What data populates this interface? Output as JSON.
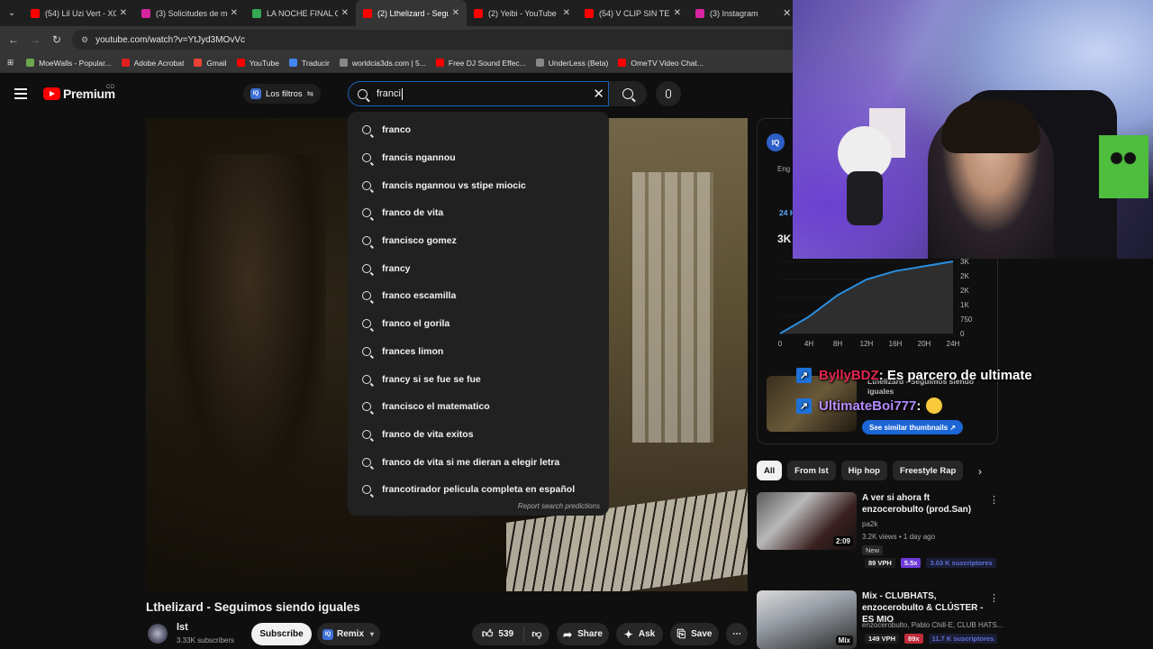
{
  "browser": {
    "tabs": [
      {
        "label": "(54) Lil Uzi Vert - XO",
        "color": "#ff0000",
        "active": false
      },
      {
        "label": "(3) Solicitudes de me",
        "color": "#d6249f",
        "active": false
      },
      {
        "label": "LA NOCHE FINAL CR",
        "color": "#34a853",
        "active": false
      },
      {
        "label": "(2) Lthelizard - Segui",
        "color": "#ff0000",
        "active": true
      },
      {
        "label": "(2) Yeibi - YouTube",
        "color": "#ff0000",
        "active": false
      },
      {
        "label": "(54) V CLIP SIN TEXT",
        "color": "#ff0000",
        "active": false
      },
      {
        "label": "(3) Instagram",
        "color": "#d6249f",
        "active": false
      }
    ],
    "url": "youtube.com/watch?v=YtJyd3MOvVc",
    "bookmarks": [
      {
        "label": "MoeWalls - Popular...",
        "color": "#6aa84f"
      },
      {
        "label": "Adobe Acrobat",
        "color": "#e02020"
      },
      {
        "label": "Gmail",
        "color": "#ea4335"
      },
      {
        "label": "YouTube",
        "color": "#ff0000"
      },
      {
        "label": "Traducir",
        "color": "#4285f4"
      },
      {
        "label": "worldcia3ds.com | 5...",
        "color": "#888888"
      },
      {
        "label": "Free DJ Sound Effec...",
        "color": "#ff0000"
      },
      {
        "label": "UnderLess (Beta)",
        "color": "#888888"
      },
      {
        "label": "OmeTV Video Chat...",
        "color": "#ff0000"
      }
    ]
  },
  "header": {
    "logo_text": "Premium",
    "logo_country": "CO",
    "filters_label": "Los filtros",
    "search_value": "franci"
  },
  "suggestions": {
    "items": [
      "franco",
      "francis ngannou",
      "francis ngannou vs stipe miocic",
      "franco de vita",
      "francisco gomez",
      "francy",
      "franco escamilla",
      "franco el gorila",
      "frances limon",
      "francy si se fue se fue",
      "francisco el matematico",
      "franco de vita exitos",
      "franco de vita si me dieran a elegir letra",
      "francotirador pelicula completa en español"
    ],
    "report_label": "Report search predictions"
  },
  "video": {
    "title": "Lthelizard - Seguimos siendo iguales",
    "channel_name": "lst",
    "channel_subs": "3.33K subscribers",
    "subscribe_label": "Subscribe",
    "remix_label": "Remix",
    "likes": "539",
    "share_label": "Share",
    "ask_label": "Ask",
    "save_label": "Save"
  },
  "iq_widget": {
    "logo": "IQ",
    "eng_label": "Eng",
    "period_label": "24 H",
    "value_label": "3K",
    "thumb_label": "Lthelizard - Seguimos siendo iguales",
    "see_similar_label": "See similar thumbnails ↗"
  },
  "chart_data": {
    "type": "area",
    "x": [
      "0",
      "4H",
      "8H",
      "12H",
      "16H",
      "20H",
      "24H"
    ],
    "series": [
      {
        "values": [
          0,
          700,
          1600,
          2250,
          2600,
          2800,
          3000
        ]
      }
    ],
    "yticks": [
      "0",
      "750",
      "1K",
      "2K",
      "2K",
      "3K"
    ],
    "ylim": [
      0,
      3000
    ],
    "line_color": "#2a8fe0"
  },
  "chat": [
    {
      "user": "ByllyBDZ",
      "message": ": Es parcero de ultimate"
    },
    {
      "user": "UltimateBoi777",
      "message": ":"
    }
  ],
  "chips": [
    "All",
    "From lst",
    "Hip hop",
    "Freestyle Rap"
  ],
  "recommended": [
    {
      "title": "A ver si ahora ft enzocerobulto (prod.San)",
      "channel": "pa2k",
      "meta": "3.2K views • 1 day ago",
      "badge": "New",
      "duration": "2:09",
      "vph": "89 VPH",
      "multiplier": "5.5x",
      "subs": "3.03 K suscriptores"
    },
    {
      "title": "Mix - CLUBHATS, enzocerobulto & CLÚSTER - ES MIO",
      "channel": "enzocerobulto, Pablo Chill-E, CLUB HATS...",
      "duration": "Mix",
      "vph": "149 VPH",
      "multiplier": "89x",
      "subs": "11.7 K suscriptores"
    }
  ]
}
